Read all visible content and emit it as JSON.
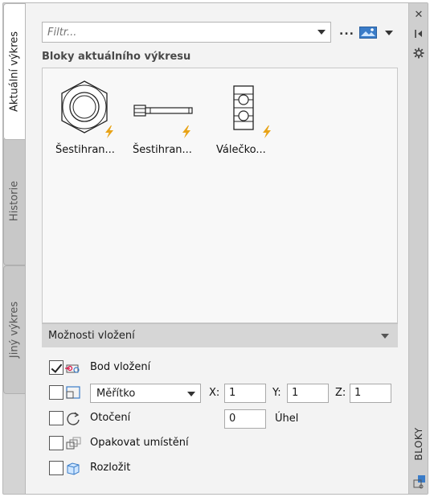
{
  "tabs": {
    "current": "Aktuální výkres",
    "history": "Historie",
    "other": "Jiný výkres"
  },
  "right_strip": {
    "title": "BLOKY",
    "close_icon": "close-icon",
    "pin_icon": "autohide-icon",
    "settings_icon": "settings-icon"
  },
  "filter": {
    "placeholder": "Filtr...",
    "value": ""
  },
  "toolbar": {
    "more_label": "...",
    "view_icon": "thumbnail-view-icon"
  },
  "section": {
    "title": "Bloky aktuálního výkresu"
  },
  "blocks": [
    {
      "name": "Šestihran...",
      "icon": "hex-nut-icon"
    },
    {
      "name": "Šestihran...",
      "icon": "hex-bolt-icon"
    },
    {
      "name": "Válečko...",
      "icon": "roller-bearing-icon"
    }
  ],
  "options": {
    "header": "Možnosti vložení",
    "insertion_point": {
      "label": "Bod vložení",
      "checked": true
    },
    "scale": {
      "checked": false,
      "selected": "Měřítko",
      "x_label": "X:",
      "x_value": "1",
      "y_label": "Y:",
      "y_value": "1",
      "z_label": "Z:",
      "z_value": "1"
    },
    "rotation": {
      "label": "Otočení",
      "checked": false,
      "angle_value": "0",
      "angle_label": "Úhel"
    },
    "repeat": {
      "label": "Opakovat umístění",
      "checked": false
    },
    "explode": {
      "label": "Rozložit",
      "checked": false
    }
  },
  "colors": {
    "bolt_accent": "#e8a317",
    "icon_blue": "#3a7cc8"
  }
}
